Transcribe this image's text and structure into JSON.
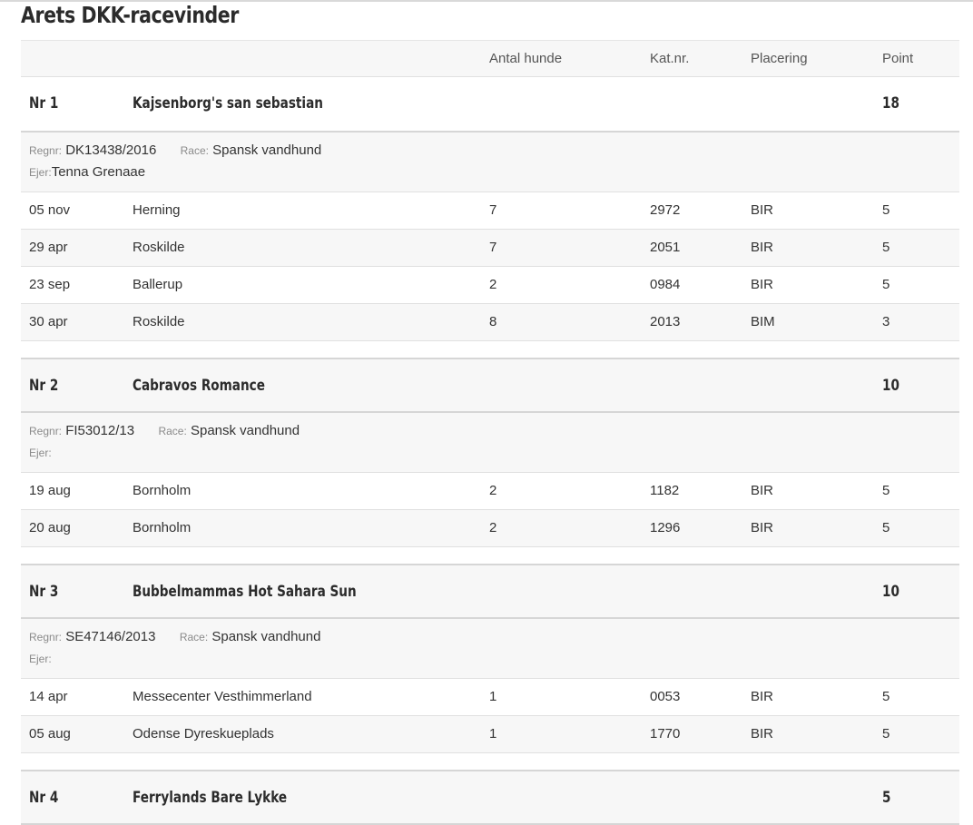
{
  "page": {
    "title": "Arets DKK-racevinder"
  },
  "headers": {
    "col1": "",
    "col2": "",
    "dogs_count": "Antal hunde",
    "cat_nr": "Kat.nr.",
    "placement": "Placering",
    "points": "Point"
  },
  "labels": {
    "regnr": "Regnr:",
    "race": "Race:",
    "owner": "Ejer:"
  },
  "dogs": [
    {
      "rank": "Nr 1",
      "name": "Kajsenborg's san sebastian",
      "points": "18",
      "regnr": "DK13438/2016",
      "race": "Spansk vandhund",
      "owner": "Tenna Grenaae",
      "results": [
        {
          "date": "05 nov",
          "place": "Herning",
          "count": "7",
          "cat": "2972",
          "placement": "BIR",
          "points": "5"
        },
        {
          "date": "29 apr",
          "place": "Roskilde",
          "count": "7",
          "cat": "2051",
          "placement": "BIR",
          "points": "5"
        },
        {
          "date": "23 sep",
          "place": "Ballerup",
          "count": "2",
          "cat": "0984",
          "placement": "BIR",
          "points": "5"
        },
        {
          "date": "30 apr",
          "place": "Roskilde",
          "count": "8",
          "cat": "2013",
          "placement": "BIM",
          "points": "3"
        }
      ]
    },
    {
      "rank": "Nr 2",
      "name": "Cabravos Romance",
      "points": "10",
      "regnr": "FI53012/13",
      "race": "Spansk vandhund",
      "owner": "",
      "results": [
        {
          "date": "19 aug",
          "place": "Bornholm",
          "count": "2",
          "cat": "1182",
          "placement": "BIR",
          "points": "5"
        },
        {
          "date": "20 aug",
          "place": "Bornholm",
          "count": "2",
          "cat": "1296",
          "placement": "BIR",
          "points": "5"
        }
      ]
    },
    {
      "rank": "Nr 3",
      "name": "Bubbelmammas Hot Sahara Sun",
      "points": "10",
      "regnr": "SE47146/2013",
      "race": "Spansk vandhund",
      "owner": "",
      "results": [
        {
          "date": "14 apr",
          "place": "Messecenter Vesthimmerland",
          "count": "1",
          "cat": "0053",
          "placement": "BIR",
          "points": "5"
        },
        {
          "date": "05 aug",
          "place": "Odense Dyreskueplads",
          "count": "1",
          "cat": "1770",
          "placement": "BIR",
          "points": "5"
        }
      ]
    },
    {
      "rank": "Nr 4",
      "name": "Ferrylands Bare Lykke",
      "points": "5"
    }
  ]
}
